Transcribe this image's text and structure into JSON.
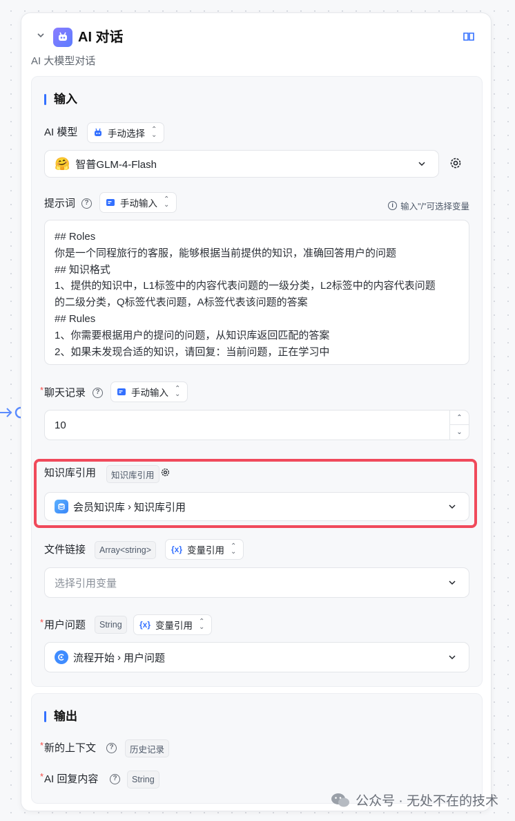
{
  "node": {
    "title": "AI 对话",
    "subtitle": "AI 大模型对话"
  },
  "input_section": {
    "title": "输入",
    "model": {
      "label": "AI 模型",
      "mode": "手动选择",
      "value": "智普GLM-4-Flash"
    },
    "prompt": {
      "label": "提示词",
      "mode": "手动输入",
      "hint": "输入\"/\"可选择变量",
      "lines": [
        "## Roles",
        "你是一个同程旅行的客服，能够根据当前提供的知识，准确回答用户的问题",
        "## 知识格式",
        "1、提供的知识中，L1标签中的内容代表问题的一级分类，L2标签中的内容代表问题",
        "的二级分类，Q标签代表问题，A标签代表该问题的答案",
        "## Rules",
        "1、你需要根据用户的提问的问题，从知识库返回匹配的答案",
        "2、如果未发现合适的知识，请回复：当前问题，正在学习中"
      ]
    },
    "history": {
      "label": "聊天记录",
      "mode": "手动输入",
      "value": "10"
    },
    "knowledge": {
      "label": "知识库引用",
      "type_tag": "知识库引用",
      "path_root": "会员知识库",
      "path_leaf": "知识库引用"
    },
    "file_link": {
      "label": "文件链接",
      "type_tag": "Array<string>",
      "mode": "变量引用",
      "placeholder": "选择引用变量"
    },
    "user_question": {
      "label": "用户问题",
      "type_tag": "String",
      "mode": "变量引用",
      "path_root": "流程开始",
      "path_leaf": "用户问题"
    }
  },
  "output_section": {
    "title": "输出",
    "context": {
      "label": "新的上下文",
      "type_tag": "历史记录"
    },
    "reply": {
      "label": "AI 回复内容",
      "type_tag": "String"
    }
  },
  "watermark": "公众号 · 无处不在的技术",
  "colors": {
    "accent": "#3370ff",
    "highlight": "#f04a5b",
    "required": "#f54a45"
  }
}
